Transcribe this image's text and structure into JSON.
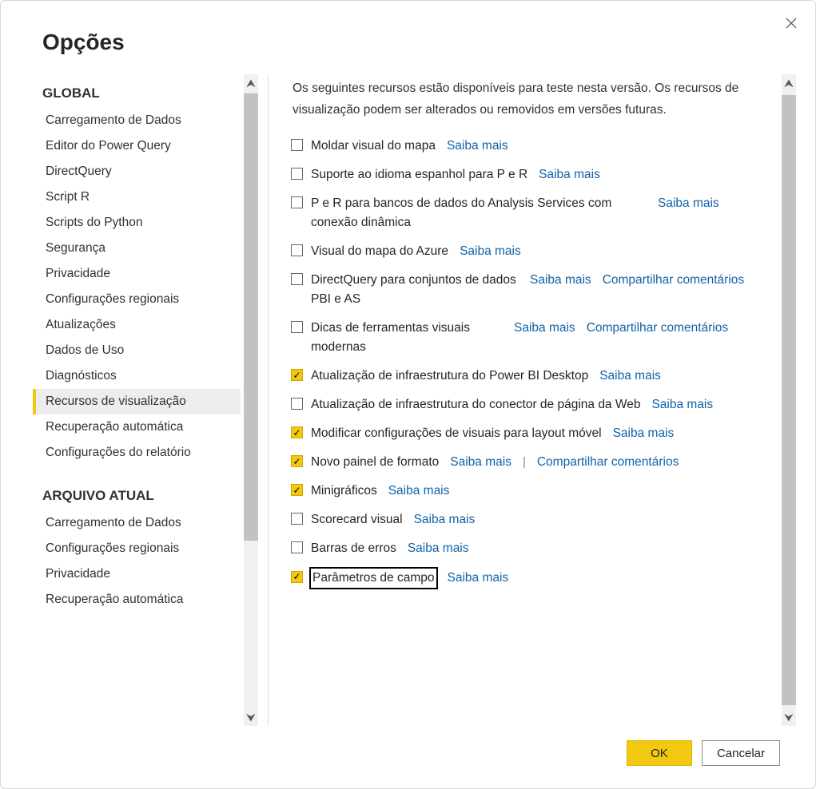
{
  "title": "Opções",
  "sidebar": {
    "global_head": "GLOBAL",
    "file_head": "ARQUIVO ATUAL",
    "global": [
      "Carregamento de Dados",
      "Editor do Power Query",
      "DirectQuery",
      "Script R",
      "Scripts do Python",
      "Segurança",
      "Privacidade",
      "Configurações regionais",
      "Atualizações",
      "Dados de Uso",
      "Diagnósticos",
      "Recursos de visualização",
      "Recuperação automática",
      "Configurações do relatório"
    ],
    "file": [
      "Carregamento de Dados",
      "Configurações regionais",
      "Privacidade",
      "Recuperação automática"
    ]
  },
  "content": {
    "desc": "Os seguintes recursos estão disponíveis para teste nesta versão. Os recursos de visualização podem ser alterados ou removidos em versões futuras.",
    "learn": "Saiba mais",
    "share": "Compartilhar comentários",
    "features": {
      "f0": {
        "label": "Moldar visual do mapa"
      },
      "f1": {
        "label": "Suporte ao idioma espanhol para P e R"
      },
      "f2": {
        "label": "P e R para bancos de dados do Analysis Services com conexão dinâmica"
      },
      "f3": {
        "label": "Visual do mapa do Azure"
      },
      "f4": {
        "label": "DirectQuery para conjuntos de dados PBI e AS"
      },
      "f5": {
        "label": "Dicas de ferramentas visuais modernas"
      },
      "f6": {
        "label": "Atualização de infraestrutura do Power BI Desktop"
      },
      "f7": {
        "label": "Atualização de infraestrutura do conector de página da Web"
      },
      "f8": {
        "label": "Modificar configurações de visuais para layout móvel"
      },
      "f9": {
        "label": "Novo painel de formato"
      },
      "f10": {
        "label": "Minigráficos"
      },
      "f11": {
        "label": "Scorecard visual"
      },
      "f12": {
        "label": "Barras de erros"
      },
      "f13": {
        "label": "Parâmetros de campo"
      }
    }
  },
  "footer": {
    "ok": "OK",
    "cancel": "Cancelar"
  }
}
